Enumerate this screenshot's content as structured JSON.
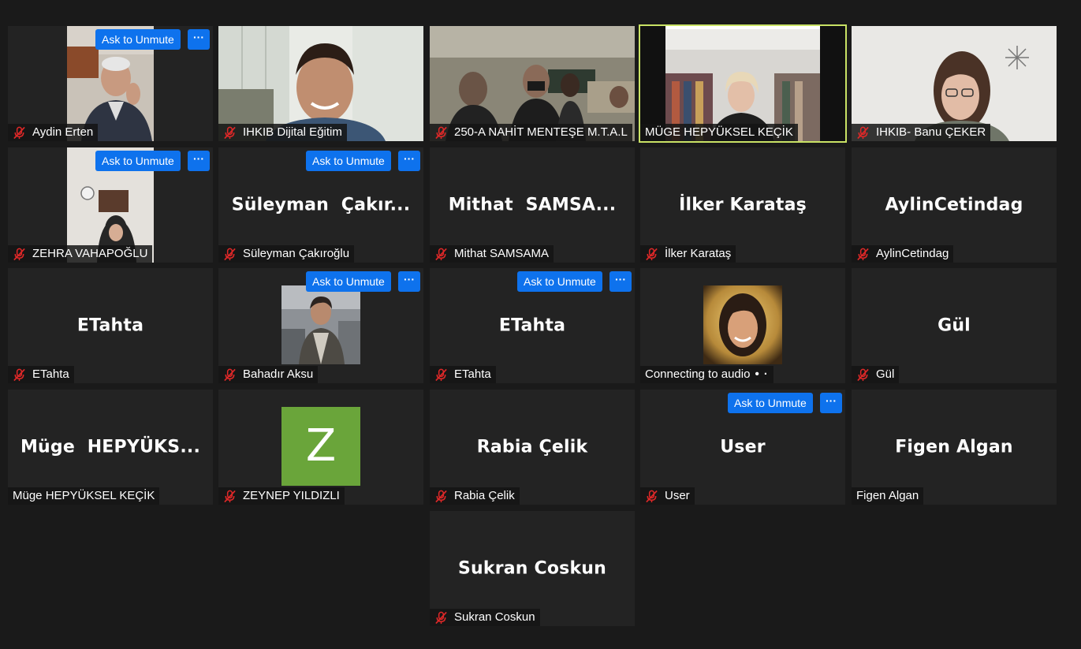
{
  "meeting": {
    "ask_unmute_label": "Ask to Unmute",
    "more_label": "···",
    "colors": {
      "tile_bg": "#232323",
      "page_bg": "#1a1a1a",
      "button_blue": "#0e72ed",
      "active_speaker_border": "#c9e265",
      "muted_mic_red": "#e02828",
      "letter_avatar_green": "#6aa53a"
    },
    "icons": {
      "mic_muted": "mic-muted-icon",
      "more": "more-icon"
    }
  },
  "participants": [
    {
      "name": "Aydin Erten",
      "display": "video",
      "muted": true,
      "ask_unmute": true
    },
    {
      "name": "IHKIB Dijital Eğitim",
      "display": "video",
      "muted": true,
      "ask_unmute": false
    },
    {
      "name": "250-A NAHİT MENTEŞE M.T.A.L",
      "display": "video",
      "muted": true,
      "ask_unmute": false
    },
    {
      "name": "MÜGE HEPYÜKSEL KEÇİK",
      "display": "video",
      "muted": false,
      "active_speaker": true,
      "ask_unmute": false
    },
    {
      "name": "IHKIB- Banu ÇEKER",
      "display": "video",
      "muted": true,
      "ask_unmute": false
    },
    {
      "name": "ZEHRA VAHAPOĞLU",
      "display": "video",
      "muted": true,
      "ask_unmute": true
    },
    {
      "name": "Süleyman Çakıroğlu",
      "big_name": "Süleyman  Çakır...",
      "display": "name",
      "muted": true,
      "ask_unmute": true
    },
    {
      "name": "Mithat SAMSAMA",
      "big_name": "Mithat  SAMSA...",
      "display": "name",
      "muted": true,
      "ask_unmute": false
    },
    {
      "name": "İlker Karataş",
      "big_name": "İlker Karataş",
      "display": "name",
      "muted": true,
      "ask_unmute": false
    },
    {
      "name": "AylinCetindag",
      "big_name": "AylinCetindag",
      "display": "name",
      "muted": true,
      "ask_unmute": false
    },
    {
      "name": "ETahta",
      "big_name": "ETahta",
      "display": "name",
      "muted": true,
      "ask_unmute": false
    },
    {
      "name": "Bahadır Aksu",
      "display": "profile_photo",
      "muted": true,
      "ask_unmute": true
    },
    {
      "name": "ETahta",
      "big_name": "ETahta",
      "display": "name",
      "muted": true,
      "ask_unmute": true
    },
    {
      "name": "Connecting to audio",
      "status_suffix": "• ·",
      "display": "profile_photo",
      "muted": false,
      "ask_unmute": false
    },
    {
      "name": "Gül",
      "big_name": "Gül",
      "display": "name",
      "muted": true,
      "ask_unmute": false
    },
    {
      "name": "Müge HEPYÜKSEL KEÇİK",
      "big_name": "Müge  HEPYÜKS...",
      "display": "name",
      "muted": false,
      "ask_unmute": false
    },
    {
      "name": "ZEYNEP YILDIZLI",
      "avatar_letter": "Z",
      "display": "letter",
      "muted": true,
      "ask_unmute": false
    },
    {
      "name": "Rabia Çelik",
      "big_name": "Rabia Çelik",
      "display": "name",
      "muted": true,
      "ask_unmute": false
    },
    {
      "name": "User",
      "big_name": "User",
      "display": "name",
      "muted": true,
      "ask_unmute": true
    },
    {
      "name": "Figen Algan",
      "big_name": "Figen Algan",
      "display": "name",
      "muted": false,
      "ask_unmute": false
    },
    {
      "name": "Sukran Coskun",
      "big_name": "Sukran Coskun",
      "display": "name",
      "muted": true,
      "ask_unmute": false
    }
  ]
}
